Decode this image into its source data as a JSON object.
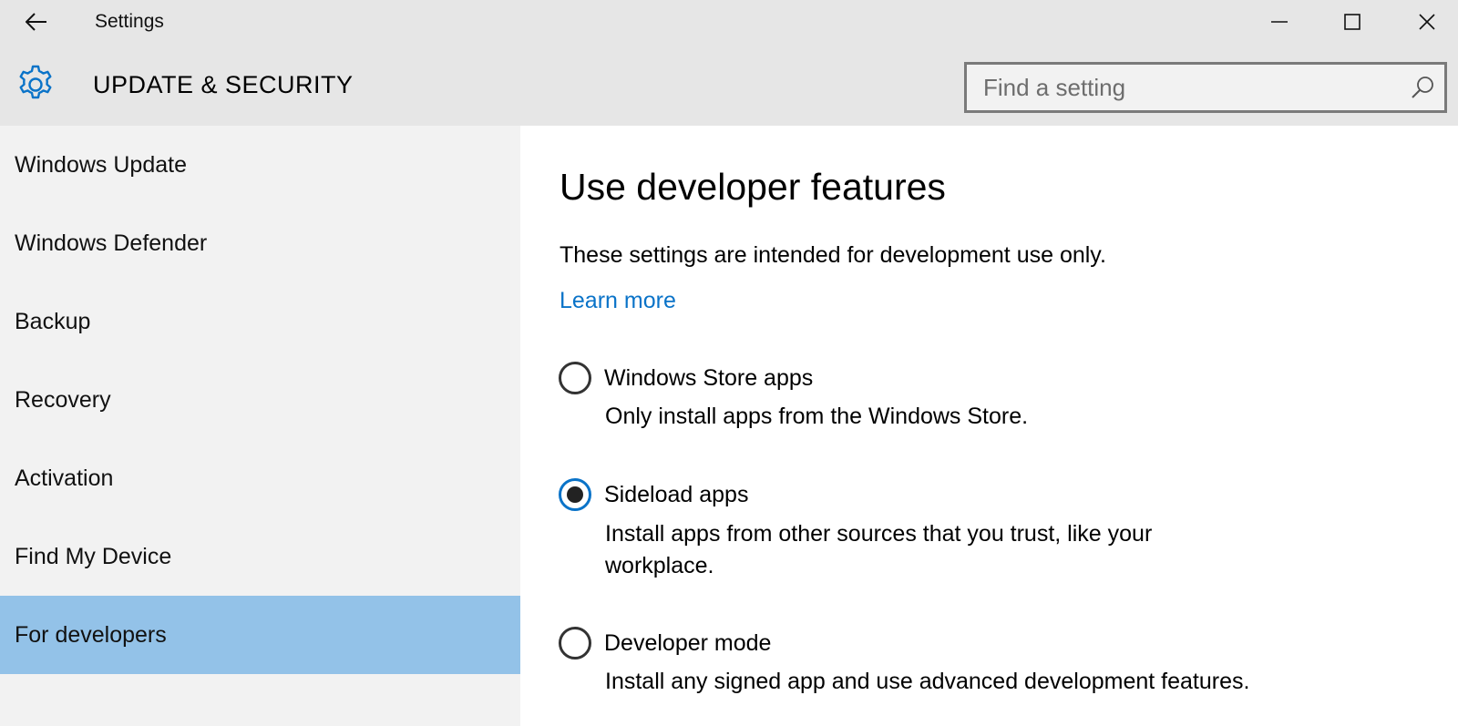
{
  "window": {
    "title": "Settings",
    "controls": {
      "minimize": "minimize-icon",
      "maximize": "maximize-icon",
      "close": "close-icon"
    }
  },
  "header": {
    "title": "UPDATE & SECURITY",
    "icon": "gear-icon",
    "search": {
      "placeholder": "Find a setting",
      "value": ""
    }
  },
  "sidebar": {
    "items": [
      {
        "label": "Windows Update",
        "selected": false
      },
      {
        "label": "Windows Defender",
        "selected": false
      },
      {
        "label": "Backup",
        "selected": false
      },
      {
        "label": "Recovery",
        "selected": false
      },
      {
        "label": "Activation",
        "selected": false
      },
      {
        "label": "Find My Device",
        "selected": false
      },
      {
        "label": "For developers",
        "selected": true
      }
    ]
  },
  "main": {
    "title": "Use developer features",
    "description": "These settings are intended for development use only.",
    "learn_more": "Learn more",
    "options": [
      {
        "label": "Windows Store apps",
        "description": "Only install apps from the Windows Store.",
        "checked": false
      },
      {
        "label": "Sideload apps",
        "description": "Install apps from other sources that you trust, like your workplace.",
        "checked": true
      },
      {
        "label": "Developer mode",
        "description": "Install any signed app and use advanced development features.",
        "checked": false
      }
    ]
  },
  "colors": {
    "accent": "#0a73c8",
    "selected_nav": "#93c2e8",
    "chrome": "#e6e6e6",
    "sidebar": "#f2f2f2"
  }
}
